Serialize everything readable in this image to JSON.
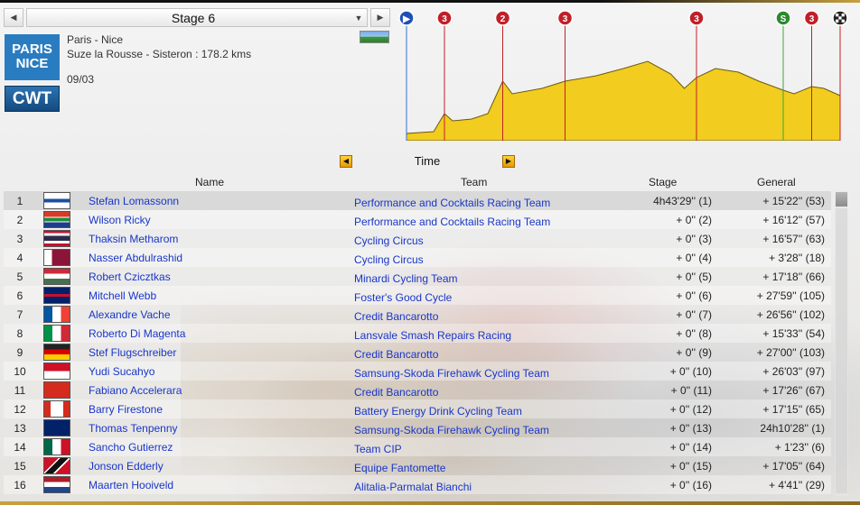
{
  "stage_selector": {
    "label": "Stage 6",
    "prev_symbol": "◀",
    "next_symbol": "▶",
    "dropdown_symbol": "▼"
  },
  "race": {
    "logo_text_1": "PARIS",
    "logo_text_2": "NICE",
    "category_badge": "CWT",
    "name": "Paris - Nice",
    "route": "Suze la Rousse - Sisteron : 178.2 kms",
    "date": "09/03",
    "terrain_icon": "hilly-terrain-icon"
  },
  "profile": {
    "markers": [
      {
        "type": "start",
        "symbol": "▶",
        "color": "#1f4fb5",
        "km": 0
      },
      {
        "type": "climb",
        "symbol": "3",
        "color": "#c0202a",
        "km": 28
      },
      {
        "type": "climb",
        "symbol": "2",
        "color": "#c0202a",
        "km": 71
      },
      {
        "type": "climb",
        "symbol": "3",
        "color": "#c0202a",
        "km": 117
      },
      {
        "type": "climb",
        "symbol": "3",
        "color": "#c0202a",
        "km": 214
      },
      {
        "type": "sprint",
        "symbol": "S",
        "color": "#2d8a2d",
        "km": 278
      },
      {
        "type": "climb",
        "symbol": "3",
        "color": "#c0202a",
        "km": 299
      },
      {
        "type": "finish",
        "symbol": "finish-flag",
        "color": "#222222",
        "km": 320
      }
    ],
    "fill_color": "#f2cc1e"
  },
  "time_nav": {
    "label": "Time",
    "prev_symbol": "◀",
    "next_symbol": "▶"
  },
  "columns": {
    "name": "Name",
    "team": "Team",
    "stage": "Stage",
    "general": "General"
  },
  "riders": [
    {
      "pos": "1",
      "flag": "finland",
      "name": "Stefan Lomassonn",
      "team": "Performance and Cocktails Racing Team",
      "stage": "4h43'29'' (1)",
      "general": "+ 15'22'' (53)"
    },
    {
      "pos": "2",
      "flag": "south-africa",
      "name": "Wilson Ricky",
      "team": "Performance and Cocktails Racing Team",
      "stage": "+ 0'' (2)",
      "general": "+ 16'12'' (57)"
    },
    {
      "pos": "3",
      "flag": "thailand",
      "name": "Thaksin Metharom",
      "team": "Cycling Circus",
      "stage": "+ 0'' (3)",
      "general": "+ 16'57'' (63)"
    },
    {
      "pos": "4",
      "flag": "qatar",
      "name": "Nasser Abdulrashid",
      "team": "Cycling Circus",
      "stage": "+ 0'' (4)",
      "general": "+ 3'28'' (18)"
    },
    {
      "pos": "5",
      "flag": "hungary",
      "name": "Robert Czicztkas",
      "team": "Minardi Cycling Team",
      "stage": "+ 0'' (5)",
      "general": "+ 17'18'' (66)"
    },
    {
      "pos": "6",
      "flag": "united-kingdom",
      "name": "Mitchell Webb",
      "team": "Foster's Good Cycle",
      "stage": "+ 0'' (6)",
      "general": "+ 27'59'' (105)"
    },
    {
      "pos": "7",
      "flag": "france",
      "name": "Alexandre Vache",
      "team": "Credit Bancarotto",
      "stage": "+ 0'' (7)",
      "general": "+ 26'56'' (102)"
    },
    {
      "pos": "8",
      "flag": "italy",
      "name": "Roberto Di Magenta",
      "team": "Lansvale Smash Repairs Racing",
      "stage": "+ 0'' (8)",
      "general": "+ 15'33'' (54)"
    },
    {
      "pos": "9",
      "flag": "germany",
      "name": "Stef Flugschreiber",
      "team": "Credit Bancarotto",
      "stage": "+ 0'' (9)",
      "general": "+ 27'00'' (103)"
    },
    {
      "pos": "10",
      "flag": "indonesia",
      "name": "Yudi Sucahyo",
      "team": "Samsung-Skoda Firehawk Cycling Team",
      "stage": "+ 0'' (10)",
      "general": "+ 26'03'' (97)"
    },
    {
      "pos": "11",
      "flag": "switzerland",
      "name": "Fabiano Accelerara",
      "team": "Credit Bancarotto",
      "stage": "+ 0'' (11)",
      "general": "+ 17'26'' (67)"
    },
    {
      "pos": "12",
      "flag": "canada",
      "name": "Barry Firestone",
      "team": "Battery Energy Drink Cycling Team",
      "stage": "+ 0'' (12)",
      "general": "+ 17'15'' (65)"
    },
    {
      "pos": "13",
      "flag": "australia",
      "name": "Thomas Tenpenny",
      "team": "Samsung-Skoda Firehawk Cycling Team",
      "stage": "+ 0'' (13)",
      "general": "24h10'28'' (1)"
    },
    {
      "pos": "14",
      "flag": "mexico",
      "name": "Sancho Gutierrez",
      "team": "Team CIP",
      "stage": "+ 0'' (14)",
      "general": "+ 1'23'' (6)"
    },
    {
      "pos": "15",
      "flag": "trinidad-and-tobago",
      "name": "Jonson Edderly",
      "team": "Equipe Fantomette",
      "stage": "+ 0'' (15)",
      "general": "+ 17'05'' (64)"
    },
    {
      "pos": "16",
      "flag": "netherlands",
      "name": "Maarten Hooiveld",
      "team": "Alitalia-Parmalat Bianchi",
      "stage": "+ 0'' (16)",
      "general": "+ 4'41'' (29)"
    }
  ]
}
